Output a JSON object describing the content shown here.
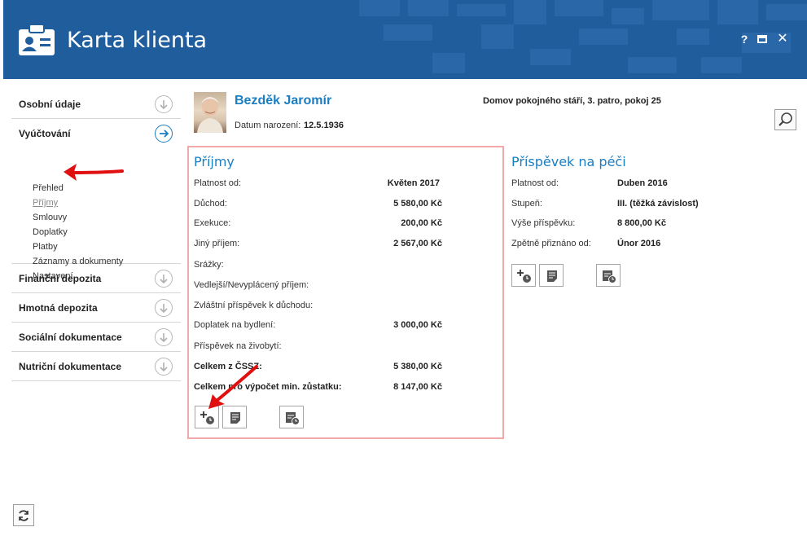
{
  "window": {
    "title": "Karta klienta",
    "help": "?",
    "close": "✕"
  },
  "sidebar": {
    "sections": [
      {
        "label": "Osobní údaje"
      },
      {
        "label": "Vyúčtování",
        "sub_items": [
          "Přehled",
          "Příjmy",
          "Smlouvy",
          "Doplatky",
          "Platby",
          "Záznamy a dokumenty",
          "Nastavení"
        ],
        "active_sub": "Příjmy"
      },
      {
        "label": "Finanční depozita"
      },
      {
        "label": "Hmotná depozita"
      },
      {
        "label": "Sociální dokumentace"
      },
      {
        "label": "Nutriční dokumentace"
      }
    ]
  },
  "client": {
    "name": "Bezděk Jaromír",
    "dob_label": "Datum narození:",
    "dob": "12.5.1936",
    "location": "Domov pokojného stáří, 3. patro, pokoj 25"
  },
  "prijmy": {
    "title": "Příjmy",
    "rows": [
      {
        "label": "Platnost od:",
        "value": "Květen 2017"
      },
      {
        "label": "Důchod:",
        "value": "5 580,00 Kč"
      },
      {
        "label": "Exekuce:",
        "value": "200,00 Kč"
      },
      {
        "label": "Jiný příjem:",
        "value": "2 567,00 Kč"
      },
      {
        "label": "Srážky:",
        "value": ""
      },
      {
        "label": "Vedlejší/Nevyplácený příjem:",
        "value": ""
      },
      {
        "label": "Zvláštní příspěvek k důchodu:",
        "value": ""
      },
      {
        "label": "Doplatek na bydlení:",
        "value": "3 000,00 Kč"
      },
      {
        "label": "Příspěvek na živobytí:",
        "value": ""
      },
      {
        "label": "Celkem z ČSSZ:",
        "value": "5 380,00 Kč"
      },
      {
        "label": "Celkem pro výpočet min. zůstatku:",
        "value": "8 147,00 Kč"
      }
    ]
  },
  "prispevek": {
    "title": "Příspěvek na péči",
    "rows": [
      {
        "label": "Platnost od:",
        "value": "Duben 2016"
      },
      {
        "label": "Stupeň:",
        "value": "III. (těžká závislost)"
      },
      {
        "label": "Výše příspěvku:",
        "value": "8 800,00 Kč"
      },
      {
        "label": "Zpětně přiznáno od:",
        "value": "Únor 2016"
      }
    ]
  },
  "colors": {
    "header": "#1f5d9d",
    "accent": "#1b7ec2",
    "highlight_border": "#f0a8a8",
    "annotation_arrow": "#e01010"
  },
  "icons": [
    "id-card-icon",
    "search-icon",
    "add-history-icon",
    "note-icon",
    "calendar-history-icon",
    "refresh-icon",
    "arrow-down-circle-icon",
    "arrow-right-circle-icon"
  ]
}
